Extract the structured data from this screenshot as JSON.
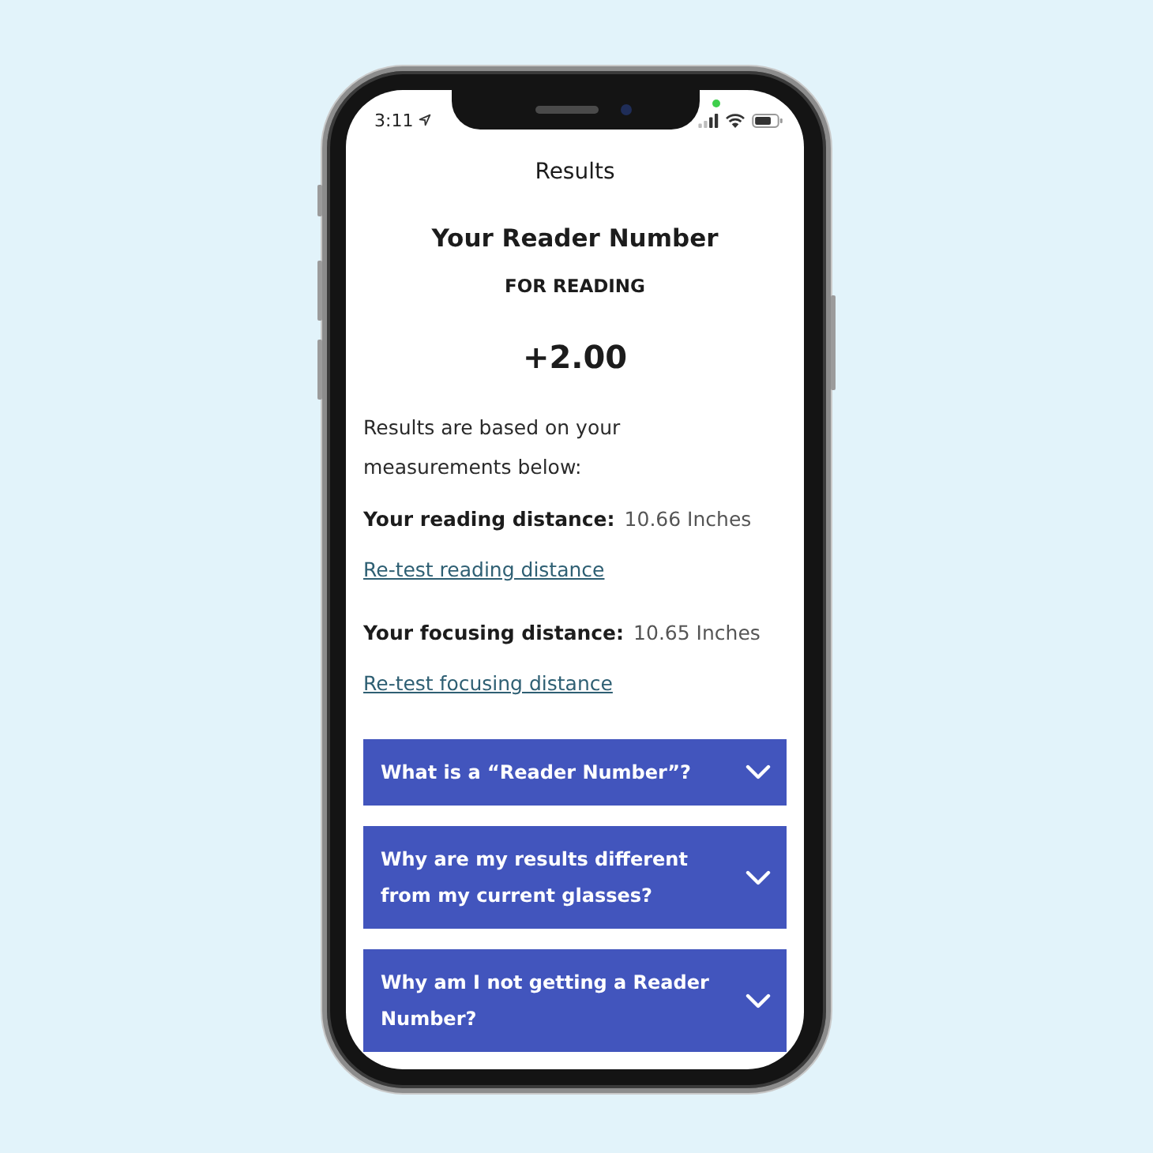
{
  "status_bar": {
    "time": "3:11"
  },
  "header": {
    "title": "Results"
  },
  "result": {
    "heading": "Your Reader Number",
    "subheading": "FOR READING",
    "value": "+2.00",
    "note": "Results are based on your measurements below:"
  },
  "measurements": [
    {
      "label": "Your reading distance:",
      "value": "10.66 Inches",
      "link": "Re-test reading distance"
    },
    {
      "label": "Your focusing distance:",
      "value": "10.65 Inches",
      "link": "Re-test focusing distance"
    }
  ],
  "faq": [
    {
      "question": "What is a “Reader Number”?",
      "expanded": false
    },
    {
      "question": "Why are my results different from my current glasses?",
      "expanded": false
    },
    {
      "question": "Why am I not getting a Reader Number?",
      "expanded": false
    }
  ]
}
